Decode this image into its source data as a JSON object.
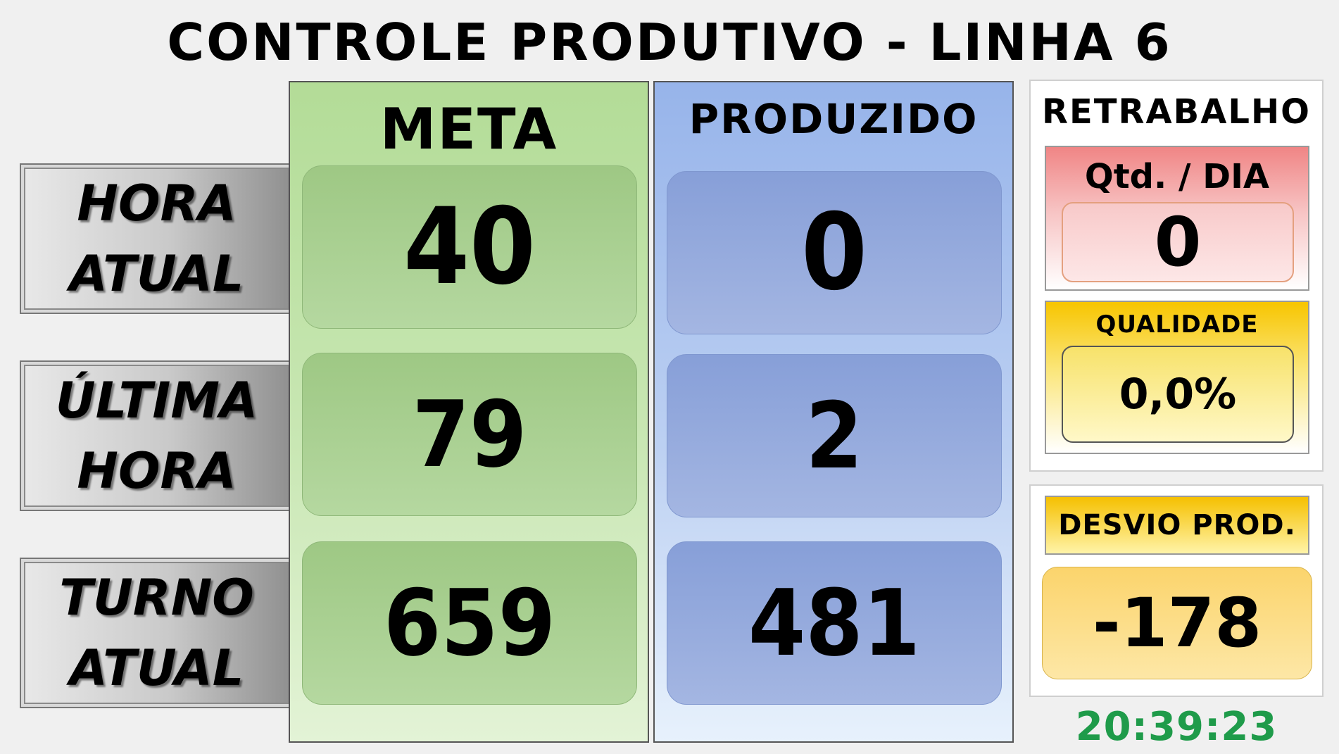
{
  "title": "CONTROLE PRODUTIVO - LINHA 6",
  "rows": [
    {
      "line1": "HORA",
      "line2": "ATUAL"
    },
    {
      "line1": "ÚLTIMA",
      "line2": "HORA"
    },
    {
      "line1": "TURNO",
      "line2": "ATUAL"
    }
  ],
  "meta": {
    "header": "META",
    "values": [
      "40",
      "79",
      "659"
    ]
  },
  "produzido": {
    "header": "PRODUZIDO",
    "values": [
      "0",
      "2",
      "481"
    ]
  },
  "retrabalho": {
    "title": "RETRABALHO",
    "qtd_label": "Qtd. / DIA",
    "qtd_value": "0",
    "qualidade_label": "QUALIDADE",
    "qualidade_value": "0,0%"
  },
  "desvio": {
    "label": "DESVIO PROD.",
    "value": "-178"
  },
  "clock": "20:39:23",
  "colors": {
    "meta": "#b3dc97",
    "produzido": "#97b4ea",
    "retrabalho": "#f08585",
    "qualidade": "#f7c500",
    "clock": "#1f9b4a"
  }
}
